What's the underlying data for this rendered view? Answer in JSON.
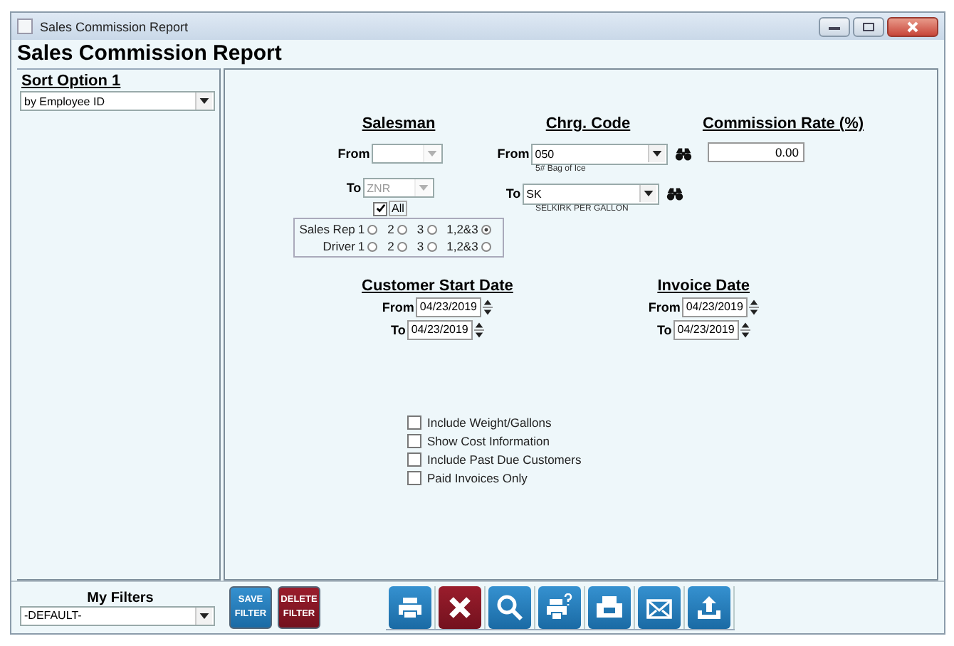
{
  "window": {
    "title": "Sales Commission Report"
  },
  "heading": "Sales Commission Report",
  "sort_option": {
    "title": "Sort Option 1",
    "value": "by Employee ID"
  },
  "salesman": {
    "title": "Salesman",
    "from": {
      "label": "From",
      "disabled": true
    },
    "to": {
      "label": "To",
      "value": "ZNR",
      "disabled": true
    },
    "all": {
      "label": "All",
      "checked": true
    },
    "radio_groups": [
      {
        "label": "Sales Rep",
        "options": [
          {
            "label": "1",
            "selected": false
          },
          {
            "label": "2",
            "selected": false
          },
          {
            "label": "3",
            "selected": false
          },
          {
            "label": "1,2&3",
            "selected": true
          }
        ]
      },
      {
        "label": "Driver",
        "options": [
          {
            "label": "1",
            "selected": false
          },
          {
            "label": "2",
            "selected": false
          },
          {
            "label": "3",
            "selected": false
          },
          {
            "label": "1,2&3",
            "selected": false
          }
        ]
      }
    ]
  },
  "chrg_code": {
    "title": "Chrg. Code",
    "from": {
      "label": "From",
      "value": "050",
      "description": "5# Bag of Ice"
    },
    "to": {
      "label": "To",
      "value": "SK",
      "description": "SELKIRK PER GALLON"
    }
  },
  "commission_rate": {
    "title": "Commission Rate (%)",
    "value": "0.00"
  },
  "customer_start_date": {
    "title": "Customer Start Date",
    "from": {
      "label": "From",
      "value": "04/23/2019"
    },
    "to": {
      "label": "To",
      "value": "04/23/2019"
    }
  },
  "invoice_date": {
    "title": "Invoice Date",
    "from": {
      "label": "From",
      "value": "04/23/2019"
    },
    "to": {
      "label": "To",
      "value": "04/23/2019"
    }
  },
  "options": [
    {
      "label": "Include Weight/Gallons",
      "checked": false
    },
    {
      "label": "Show Cost Information",
      "checked": false
    },
    {
      "label": "Include Past Due Customers",
      "checked": false
    },
    {
      "label": "Paid Invoices Only",
      "checked": false
    }
  ],
  "my_filters": {
    "title": "My Filters",
    "value": "-DEFAULT-"
  },
  "filter_buttons": [
    {
      "label": "SAVE FILTER",
      "kind": "save"
    },
    {
      "label": "DELETE FILTER",
      "kind": "delete"
    }
  ],
  "toolbar": [
    {
      "kind": "print"
    },
    {
      "kind": "cancel"
    },
    {
      "kind": "search"
    },
    {
      "kind": "print-help"
    },
    {
      "kind": "fax"
    },
    {
      "kind": "email"
    },
    {
      "kind": "export"
    }
  ]
}
